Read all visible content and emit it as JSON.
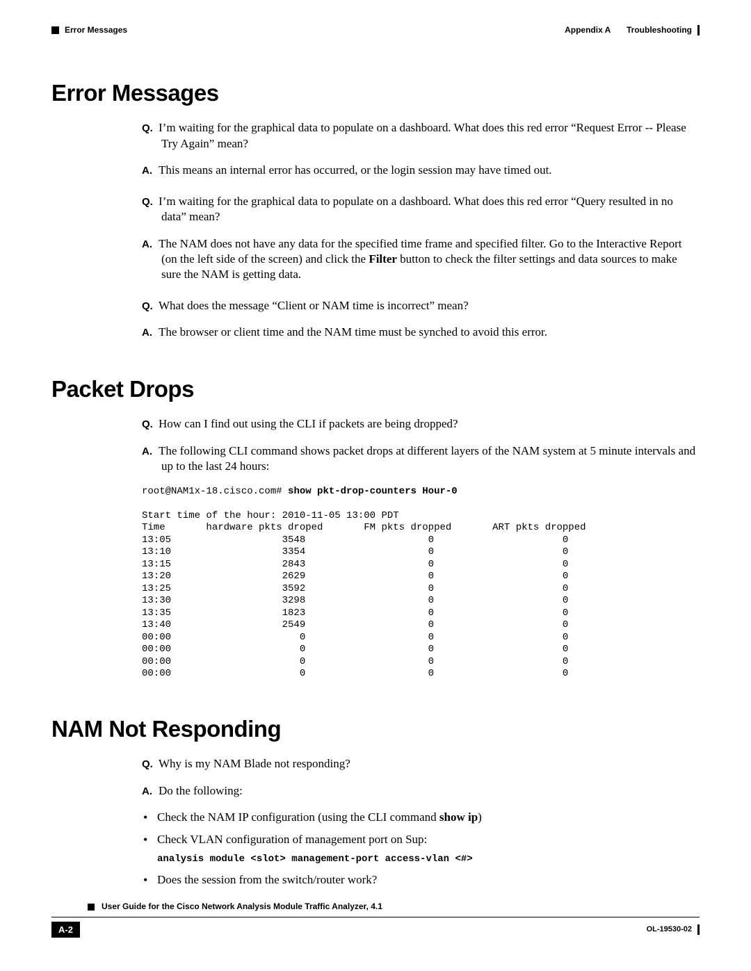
{
  "header": {
    "left_section": "Error Messages",
    "right_prefix": "Appendix A",
    "right_title": "Troubleshooting"
  },
  "sections": {
    "s1": {
      "title": "Error Messages",
      "qa": [
        {
          "q": "I’m waiting for the graphical data to populate on a dashboard. What does this red error “Request Error -- Please Try Again” mean?",
          "a": "This means an internal error has occurred, or the login session may have timed out."
        },
        {
          "q": "I’m waiting for the graphical data to populate on a dashboard. What does this red error “Query resulted in no data” mean?",
          "a_pre": "The NAM does not have any data for the specified time frame and specified filter. Go to the Interactive Report (on the left side of the screen) and click the ",
          "a_bold": "Filter",
          "a_post": " button to check the filter settings and data sources to make sure the NAM is getting data."
        },
        {
          "q": "What does the message “Client or NAM time is incorrect” mean?",
          "a": "The browser or client time and the NAM time must be synched to avoid this error."
        }
      ]
    },
    "s2": {
      "title": "Packet Drops",
      "q": "How can I find out using the CLI if packets are being dropped?",
      "a": "The following CLI command shows packet drops at different layers of the NAM system at 5 minute intervals and up to the last 24 hours:",
      "cli_prompt": "root@NAM1x-18.cisco.com# ",
      "cli_cmd": "show pkt-drop-counters Hour-0",
      "out_header": "Start time of the hour: 2010-11-05 13:00 PDT",
      "out_cols": "Time       hardware pkts droped       FM pkts dropped       ART pkts dropped",
      "out_rows": [
        "13:05                   3548                     0                      0",
        "13:10                   3354                     0                      0",
        "13:15                   2843                     0                      0",
        "13:20                   2629                     0                      0",
        "13:25                   3592                     0                      0",
        "13:30                   3298                     0                      0",
        "13:35                   1823                     0                      0",
        "13:40                   2549                     0                      0",
        "00:00                      0                     0                      0",
        "00:00                      0                     0                      0",
        "00:00                      0                     0                      0",
        "00:00                      0                     0                      0"
      ]
    },
    "s3": {
      "title": "NAM Not Responding",
      "q": "Why is my NAM Blade not responding?",
      "a": "Do the following:",
      "b1_pre": "Check the NAM IP configuration (using the CLI command ",
      "b1_bold": "show ip",
      "b1_post": ")",
      "b2": "Check VLAN configuration of management port on Sup:",
      "b2_code": "analysis module <slot> management-port access-vlan <#>",
      "b3": "Does the session from the switch/router work?"
    }
  },
  "labels": {
    "q": "Q.",
    "a": "A."
  },
  "footer": {
    "guide_title": "User Guide for the Cisco Network Analysis Module Traffic Analyzer, 4.1",
    "page_number": "A-2",
    "doc_id": "OL-19530-02"
  }
}
